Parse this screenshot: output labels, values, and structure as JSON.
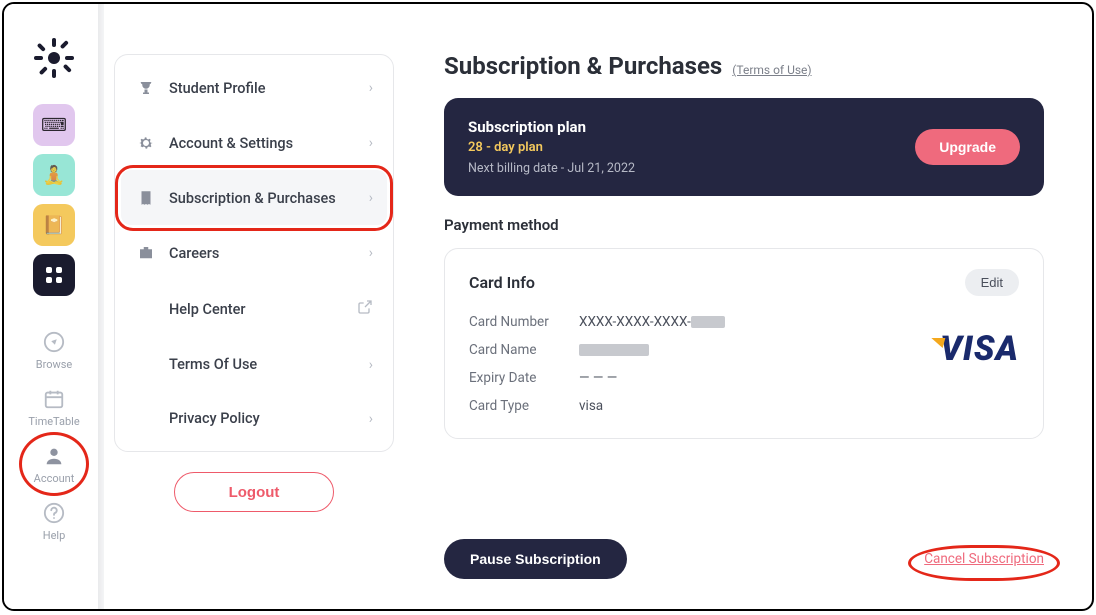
{
  "sidebar": {
    "nav": {
      "browse": "Browse",
      "timetable": "TimeTable",
      "account": "Account",
      "help": "Help"
    }
  },
  "menu": {
    "items": [
      {
        "label": "Student Profile"
      },
      {
        "label": "Account & Settings"
      },
      {
        "label": "Subscription & Purchases"
      },
      {
        "label": "Careers"
      },
      {
        "label": "Help Center"
      },
      {
        "label": "Terms Of Use"
      },
      {
        "label": "Privacy Policy"
      }
    ],
    "logout": "Logout"
  },
  "main": {
    "title": "Subscription & Purchases",
    "terms_link": "(Terms of Use)",
    "plan": {
      "heading": "Subscription plan",
      "duration": "28 - day plan",
      "next_billing": "Next billing date - Jul 21, 2022",
      "upgrade_label": "Upgrade"
    },
    "payment_method_title": "Payment method",
    "card": {
      "heading": "Card Info",
      "edit_label": "Edit",
      "number_label": "Card Number",
      "number_value": "XXXX-XXXX-XXXX-",
      "name_label": "Card Name",
      "expiry_label": "Expiry Date",
      "expiry_value": "— — —",
      "type_label": "Card Type",
      "type_value": "visa",
      "brand": "VISA"
    },
    "pause_label": "Pause Subscription",
    "cancel_label": "Cancel Subscription"
  }
}
